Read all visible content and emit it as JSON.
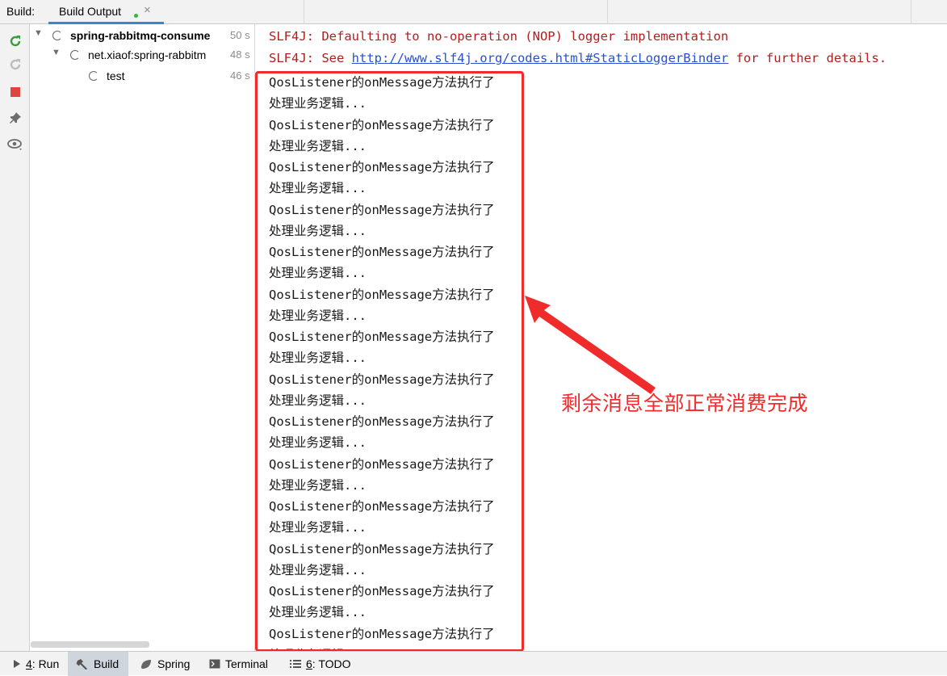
{
  "topbar": {
    "build_label": "Build:",
    "tab_label": "Build Output",
    "close_glyph": "×"
  },
  "tree": {
    "root": {
      "label": "spring-rabbitmq-consume",
      "time": "50 s"
    },
    "module": {
      "label": "net.xiaof:spring-rabbitm",
      "time": "48 s"
    },
    "task": {
      "label": "test",
      "time": "46 s"
    }
  },
  "console": {
    "line1": "SLF4J: Defaulting to no-operation (NOP) logger implementation",
    "line2_prefix": "SLF4J: See ",
    "line2_link": "http://www.slf4j.org/codes.html#StaticLoggerBinder",
    "line2_suffix": " for further details.",
    "listener_line": "QosListener的onMessage方法执行了",
    "business_line": "处理业务逻辑...",
    "repeat_count": 14
  },
  "annotation": {
    "text": "剩余消息全部正常消费完成",
    "color": "#f02b2b"
  },
  "bottom_tabs": {
    "run": {
      "mnemonic": "4",
      "label": ": Run"
    },
    "build": {
      "label": "Build"
    },
    "spring": {
      "label": "Spring"
    },
    "terminal": {
      "label": "Terminal"
    },
    "todo": {
      "mnemonic": "6",
      "label": ": TODO"
    }
  },
  "icons": {
    "rerun": "rerun-icon",
    "rerun_disabled": "rerun-failed-icon",
    "stop": "stop-icon",
    "pin": "pin-icon",
    "view": "eye-icon"
  }
}
